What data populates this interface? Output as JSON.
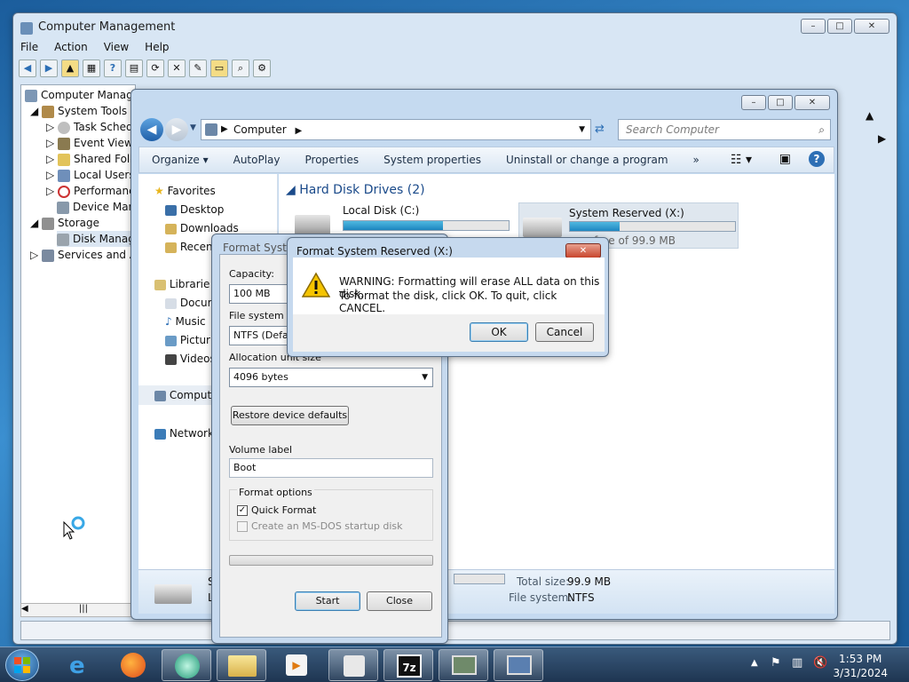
{
  "colors": {
    "accent": "#1e87c1",
    "title_blue": "#1a4a8a",
    "warning_yellow": "#f5c400",
    "close_red": "#c8442c"
  },
  "computer_management": {
    "title": "Computer Management",
    "menu": [
      "File",
      "Action",
      "View",
      "Help"
    ],
    "tree": {
      "root": "Computer Manage",
      "system_tools": "System Tools",
      "task_scheduler": "Task Schedu",
      "event_viewer": "Event Viewe",
      "shared_folders": "Shared Fold",
      "local_users": "Local Users",
      "performance": "Performanc",
      "device_manager": "Device Man",
      "storage": "Storage",
      "disk_management": "Disk Manag",
      "services": "Services and Ap"
    }
  },
  "explorer": {
    "address": "Computer",
    "search_placeholder": "Search Computer",
    "commands": [
      "Organize",
      "AutoPlay",
      "Properties",
      "System properties",
      "Uninstall or change a program",
      "»"
    ],
    "nav": {
      "favorites": "Favorites",
      "desktop": "Desktop",
      "downloads": "Downloads",
      "recent": "Recen",
      "libraries": "Librarie",
      "documents": "Docur",
      "music": "Music",
      "pictures": "Pictur",
      "videos": "Videos",
      "computer": "Comput",
      "network": "Network"
    },
    "group_header": "Hard Disk Drives (2)",
    "drives": [
      {
        "name": "Local Disk (C:)",
        "fill": 0.5,
        "free_text": ""
      },
      {
        "name": "System Reserved (X:)",
        "fill": 0.3,
        "free_text": "free of 99.9 MB"
      }
    ],
    "details": {
      "name_fragment": "S",
      "type_fragment": "L",
      "total_size_label": "Total size:",
      "total_size": "99.9 MB",
      "file_system_label": "File system:",
      "file_system": "NTFS"
    }
  },
  "format_dialog": {
    "title": "Format Syste",
    "capacity_label": "Capacity:",
    "capacity": "100 MB",
    "file_system_label": "File system",
    "file_system": "NTFS (Defau",
    "allocation_label": "Allocation unit size",
    "allocation": "4096 bytes",
    "restore_label": "Restore device defaults",
    "volume_label_label": "Volume label",
    "volume_label": "Boot",
    "format_options_label": "Format options",
    "quick_format": "Quick Format",
    "ms_dos": "Create an MS-DOS startup disk",
    "start": "Start",
    "close": "Close"
  },
  "warning_dialog": {
    "title": "Format System Reserved (X:)",
    "line1": "WARNING: Formatting will erase ALL data on this disk.",
    "line2": "To format the disk, click OK. To quit, click CANCEL.",
    "ok": "OK",
    "cancel": "Cancel"
  },
  "taskbar": {
    "time": "1:53 PM",
    "date": "3/31/2024",
    "icons": [
      "ie-icon",
      "firefox-icon",
      "app-icon",
      "explorer-icon",
      "media-icon",
      "disk-icon",
      "7zip-icon",
      "network-icon",
      "computer-management-icon"
    ]
  }
}
